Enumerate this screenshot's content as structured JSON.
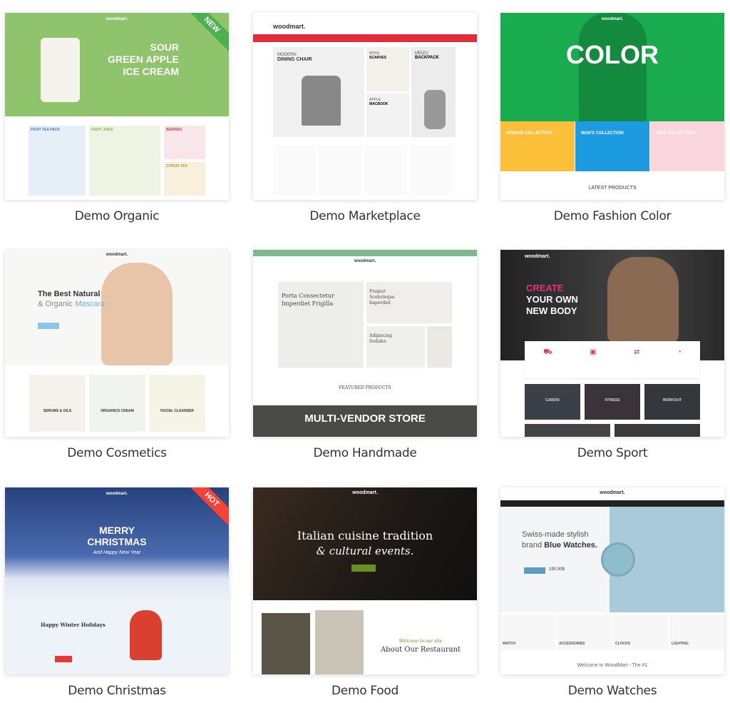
{
  "logo": "woodmart.",
  "demos": [
    {
      "caption": "Demo Organic",
      "badge": "NEW",
      "hero": [
        "SOUR",
        "GREEN APPLE",
        "ICE CREAM"
      ],
      "tiles": [
        "FRUIT TEA PACK",
        "FRUIT JUICE",
        "BERRIES",
        "CITRUS TEA"
      ],
      "colors": {
        "hero": "#8fc46c",
        "badge": "#4caf50"
      }
    },
    {
      "caption": "Demo Marketplace",
      "tiles": [
        "MODERN",
        "DINING CHAIR",
        "WOOL",
        "SCARVES",
        "MEIZU",
        "BACKPACK",
        "APPLE",
        "MACBOOK"
      ],
      "colors": {
        "bar": "#e52d3a"
      }
    },
    {
      "caption": "Demo Fashion Color",
      "hero": "COLOR",
      "tiles": [
        "WOMAN COLLECTION",
        "MAN'S COLLECTION",
        "KIDS COLLECTION"
      ],
      "section": "LATEST PRODUCTS",
      "colors": {
        "hero": "#1aab4f"
      }
    },
    {
      "caption": "Demo Cosmetics",
      "hero": [
        "The Best Natural",
        "& Organic",
        "Mascara"
      ],
      "tiles": [
        "SERUMS & OILS",
        "ORGANICS CREAM",
        "FACIAL CLEANSER"
      ]
    },
    {
      "caption": "Demo Handmade",
      "tiles": [
        "Porta Consectetur Imperdiet Frigilla",
        "Frugiat Scelerisque Imperdiet",
        "Adipiscing Sodales"
      ],
      "section": "FEATURED PRODUCTS",
      "banner": "MULTI-VENDOR STORE",
      "colors": {
        "bar": "#7fb88a"
      }
    },
    {
      "caption": "Demo Sport",
      "hero": [
        "CREATE",
        "YOUR OWN",
        "NEW BODY"
      ],
      "tiles": [
        "CARDIO",
        "FITNESS",
        "WORKOUT"
      ],
      "colors": {
        "accent": "#e8307a"
      }
    },
    {
      "caption": "Demo Christmas",
      "badge": "HOT",
      "hero": [
        "MERRY",
        "CHRISTMAS",
        "And Happy New Year"
      ],
      "section": "Happy Winter Holidays",
      "colors": {
        "hero": "#3d5a9e",
        "badge": "#f44336"
      }
    },
    {
      "caption": "Demo Food",
      "hero": [
        "Italian cuisine tradition",
        "& cultural events."
      ],
      "section": [
        "Welcome to our site",
        "About Our Restaurant"
      ]
    },
    {
      "caption": "Demo Watches",
      "hero": [
        "Swiss-made stylish",
        "brand ",
        "Blue Watches."
      ],
      "price": "190.00$",
      "tiles": [
        "WATCH",
        "ACCESSORIES",
        "CLOCKS",
        "LIGHTING"
      ],
      "section": "Welcome to WoodMart - The #1"
    }
  ]
}
